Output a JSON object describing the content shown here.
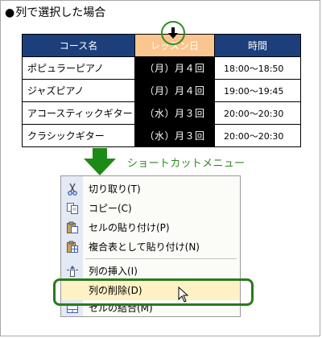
{
  "heading": {
    "bullet": "●",
    "text": "列で選択した場合"
  },
  "table": {
    "headers": [
      "コース名",
      "レッスン日",
      "時間"
    ],
    "rows": [
      {
        "course": "ポピュラーピアノ",
        "lesson": "（月）月４回",
        "time": "18:00～18:50"
      },
      {
        "course": "ジャズピアノ",
        "lesson": "（月）月４回",
        "time": "19:00～19:45"
      },
      {
        "course": "アコースティックギター",
        "lesson": "（水）月３回",
        "time": "20:00～20:30"
      },
      {
        "course": "クラシックギター",
        "lesson": "（水）月３回",
        "time": "20:00～20:30"
      }
    ]
  },
  "caption": "ショートカットメニュー",
  "menu": {
    "items": [
      {
        "label": "切り取り(T)",
        "icon": "scissors-icon"
      },
      {
        "label": "コピー(C)",
        "icon": "copy-icon"
      },
      {
        "label": "セルの貼り付け(P)",
        "icon": "paste-icon"
      },
      {
        "label": "複合表として貼り付け(N)",
        "icon": "paste-nested-icon"
      },
      {
        "label": "列の挿入(I)",
        "icon": "insert-column-icon"
      },
      {
        "label": "列の削除(D)",
        "icon": "",
        "highlighted": true
      },
      {
        "label": "セルの結合(M)",
        "icon": "merge-cells-icon"
      }
    ]
  },
  "colors": {
    "header_bg": "#1c3f7c",
    "selected_header_bg": "#fbc58f",
    "accent_green": "#2a8a1f",
    "highlight": "#fdf1c5"
  }
}
